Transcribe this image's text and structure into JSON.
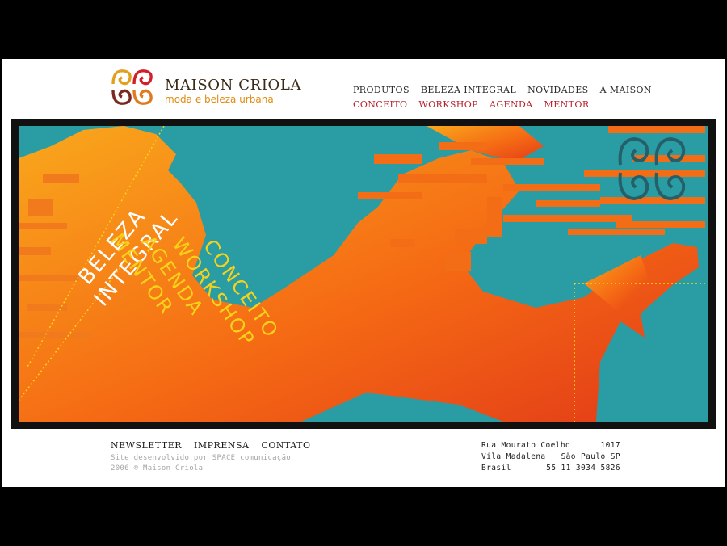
{
  "brand": {
    "name": "MAISON CRIOLA",
    "tagline": "moda e beleza urbana"
  },
  "nav_primary": [
    "PRODUTOS",
    "BELEZA INTEGRAL",
    "NOVIDADES",
    "A MAISON"
  ],
  "nav_secondary": [
    "CONCEITO",
    "WORKSHOP",
    "AGENDA",
    "MENTOR"
  ],
  "banner": {
    "heading_lines": [
      "BELEZA",
      "INTEGRAL"
    ],
    "menu_lines": [
      "CONCEITO",
      "WORKSHOP",
      "AGENDA",
      "MENTOR"
    ]
  },
  "footer_nav": [
    "NEWSLETTER",
    "IMPRENSA",
    "CONTATO"
  ],
  "credits": [
    "Site desenvolvido por SPACE comunicação",
    "2006 ® Maison Criola"
  ],
  "address": [
    {
      "left": "Rua Mourato Coelho",
      "right": "1017"
    },
    {
      "left": "Vila Madalena",
      "right": "São Paulo SP"
    },
    {
      "left": "Brasil",
      "right": "55 11 3034 5826"
    }
  ],
  "colors": {
    "accent_red": "#b8202b",
    "tagline_orange": "#e08a10",
    "teal": "#2a9ca3",
    "orange": "#f56a14",
    "yellow_text": "#f7d21a"
  }
}
